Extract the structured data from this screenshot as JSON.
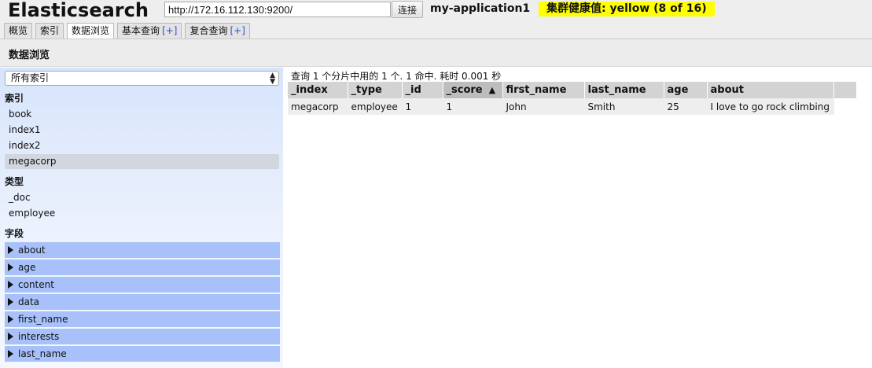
{
  "app": {
    "title": "Elasticsearch",
    "url": "http://172.16.112.130:9200/",
    "connect_label": "连接",
    "cluster_name": "my-application1",
    "health": "集群健康值: yellow (8 of 16)",
    "health_color": "#ffff00"
  },
  "tabs": [
    {
      "label": "概览",
      "plus": ""
    },
    {
      "label": "索引",
      "plus": ""
    },
    {
      "label": "数据浏览",
      "plus": ""
    },
    {
      "label": "基本查询",
      "plus": "[+]"
    },
    {
      "label": "复合查询",
      "plus": "[+]"
    }
  ],
  "active_tab": "数据浏览",
  "section_title": "数据浏览",
  "sidebar": {
    "index_select": "所有索引",
    "indices_label": "索引",
    "indices": [
      "book",
      "index1",
      "index2",
      "megacorp"
    ],
    "selected_index": "megacorp",
    "types_label": "类型",
    "types": [
      "_doc",
      "employee"
    ],
    "fields_label": "字段",
    "fields": [
      "about",
      "age",
      "content",
      "data",
      "first_name",
      "interests",
      "last_name"
    ]
  },
  "results": {
    "summary": "查询 1 个分片中用的 1 个. 1 命中. 耗时 0.001 秒",
    "columns": [
      "_index",
      "_type",
      "_id",
      "_score",
      "first_name",
      "last_name",
      "age",
      "about"
    ],
    "sort_indicator": "▲",
    "rows": [
      [
        "megacorp",
        "employee",
        "1",
        "1",
        "John",
        "Smith",
        "25",
        "I love to go rock climbing"
      ]
    ]
  }
}
